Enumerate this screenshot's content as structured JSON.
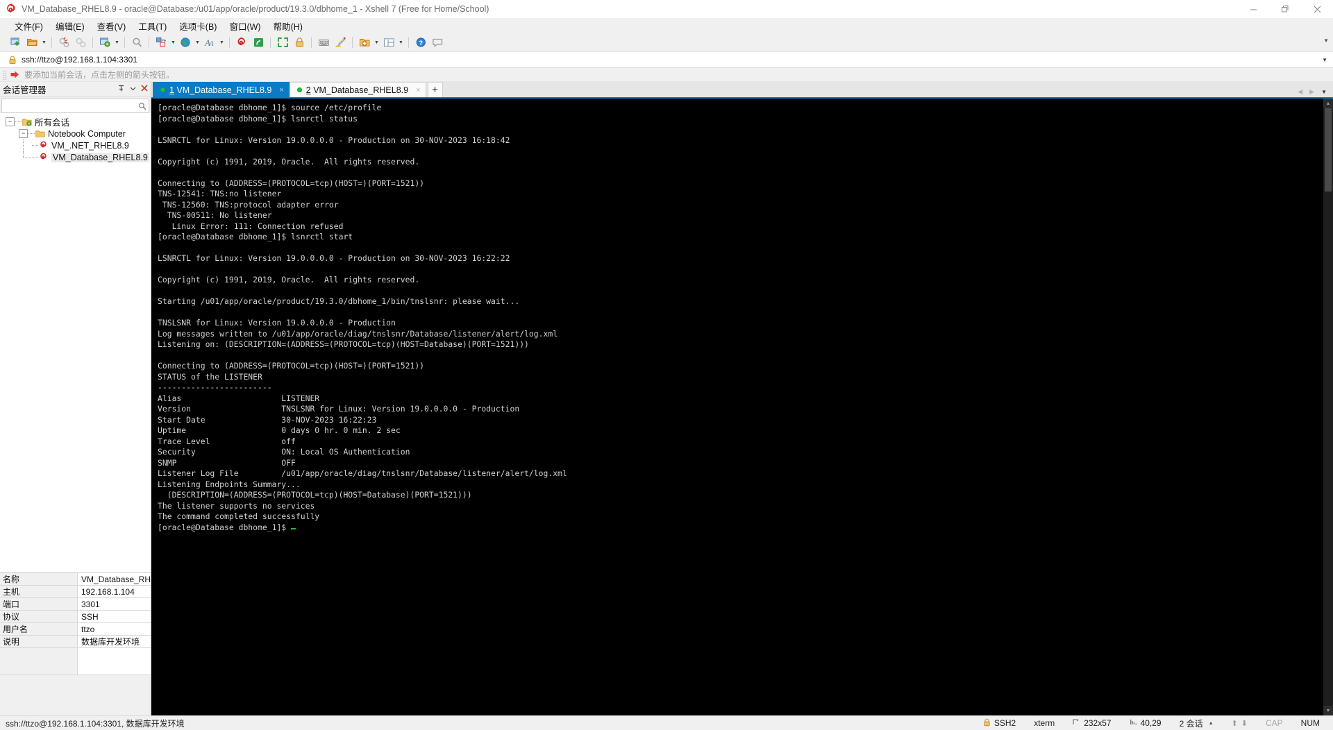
{
  "window": {
    "title": "VM_Database_RHEL8.9 - oracle@Database:/u01/app/oracle/product/19.3.0/dbhome_1 - Xshell 7 (Free for Home/School)",
    "minimize": "—",
    "maximize": "❐",
    "close": "✕"
  },
  "menubar": {
    "items": [
      {
        "label": "文件(F)",
        "name": "menu-file"
      },
      {
        "label": "编辑(E)",
        "name": "menu-edit"
      },
      {
        "label": "查看(V)",
        "name": "menu-view"
      },
      {
        "label": "工具(T)",
        "name": "menu-tools"
      },
      {
        "label": "选项卡(B)",
        "name": "menu-tabs"
      },
      {
        "label": "窗口(W)",
        "name": "menu-window"
      },
      {
        "label": "帮助(H)",
        "name": "menu-help"
      }
    ]
  },
  "address": {
    "value": "ssh://ttzo@192.168.1.104:3301",
    "lock_icon": "lock-icon"
  },
  "notice": {
    "text": "要添加当前会话，点击左侧的箭头按钮。"
  },
  "sidebar": {
    "header_title": "会话管理器",
    "search_placeholder": "",
    "search_value": "",
    "tree": [
      {
        "label": "所有会话",
        "icon": "folder-sessions-icon",
        "expander": "−",
        "level": 0
      },
      {
        "label": "Notebook Computer",
        "icon": "folder-icon",
        "expander": "−",
        "level": 1
      },
      {
        "label": "VM_.NET_RHEL8.9",
        "icon": "xshell-session-icon",
        "expander": "",
        "level": 2
      },
      {
        "label": "VM_Database_RHEL8.9",
        "icon": "xshell-session-icon",
        "expander": "",
        "level": 2,
        "selected": true
      }
    ],
    "properties": [
      {
        "key": "名称",
        "value": "VM_Database_RHE..."
      },
      {
        "key": "主机",
        "value": "192.168.1.104"
      },
      {
        "key": "端口",
        "value": "3301"
      },
      {
        "key": "协议",
        "value": "SSH"
      },
      {
        "key": "用户名",
        "value": "ttzo"
      },
      {
        "key": "说明",
        "value": "数据库开发环境"
      }
    ]
  },
  "tabs": {
    "items": [
      {
        "number": "1",
        "label": "VM_Database_RHEL8.9",
        "active": true,
        "close": "×"
      },
      {
        "number": "2",
        "label": "VM_Database_RHEL8.9",
        "active": false,
        "close": "×"
      }
    ],
    "add_label": "+"
  },
  "terminal": {
    "lines": [
      "[oracle@Database dbhome_1]$ source /etc/profile",
      "[oracle@Database dbhome_1]$ lsnrctl status",
      "",
      "LSNRCTL for Linux: Version 19.0.0.0.0 - Production on 30-NOV-2023 16:18:42",
      "",
      "Copyright (c) 1991, 2019, Oracle.  All rights reserved.",
      "",
      "Connecting to (ADDRESS=(PROTOCOL=tcp)(HOST=)(PORT=1521))",
      "TNS-12541: TNS:no listener",
      " TNS-12560: TNS:protocol adapter error",
      "  TNS-00511: No listener",
      "   Linux Error: 111: Connection refused",
      "[oracle@Database dbhome_1]$ lsnrctl start",
      "",
      "LSNRCTL for Linux: Version 19.0.0.0.0 - Production on 30-NOV-2023 16:22:22",
      "",
      "Copyright (c) 1991, 2019, Oracle.  All rights reserved.",
      "",
      "Starting /u01/app/oracle/product/19.3.0/dbhome_1/bin/tnslsnr: please wait...",
      "",
      "TNSLSNR for Linux: Version 19.0.0.0.0 - Production",
      "Log messages written to /u01/app/oracle/diag/tnslsnr/Database/listener/alert/log.xml",
      "Listening on: (DESCRIPTION=(ADDRESS=(PROTOCOL=tcp)(HOST=Database)(PORT=1521)))",
      "",
      "Connecting to (ADDRESS=(PROTOCOL=tcp)(HOST=)(PORT=1521))",
      "STATUS of the LISTENER",
      "------------------------",
      "Alias                     LISTENER",
      "Version                   TNSLSNR for Linux: Version 19.0.0.0.0 - Production",
      "Start Date                30-NOV-2023 16:22:23",
      "Uptime                    0 days 0 hr. 0 min. 2 sec",
      "Trace Level               off",
      "Security                  ON: Local OS Authentication",
      "SNMP                      OFF",
      "Listener Log File         /u01/app/oracle/diag/tnslsnr/Database/listener/alert/log.xml",
      "Listening Endpoints Summary...",
      "  (DESCRIPTION=(ADDRESS=(PROTOCOL=tcp)(HOST=Database)(PORT=1521)))",
      "The listener supports no services",
      "The command completed successfully"
    ],
    "prompt": "[oracle@Database dbhome_1]$ "
  },
  "statusbar": {
    "left": "ssh://ttzo@192.168.1.104:3301, 数据库开发环境",
    "protocol": "SSH2",
    "termtype": "xterm",
    "size": "232x57",
    "cursor": "40,29",
    "sessions": "2 会话",
    "cap": "CAP",
    "num": "NUM"
  }
}
